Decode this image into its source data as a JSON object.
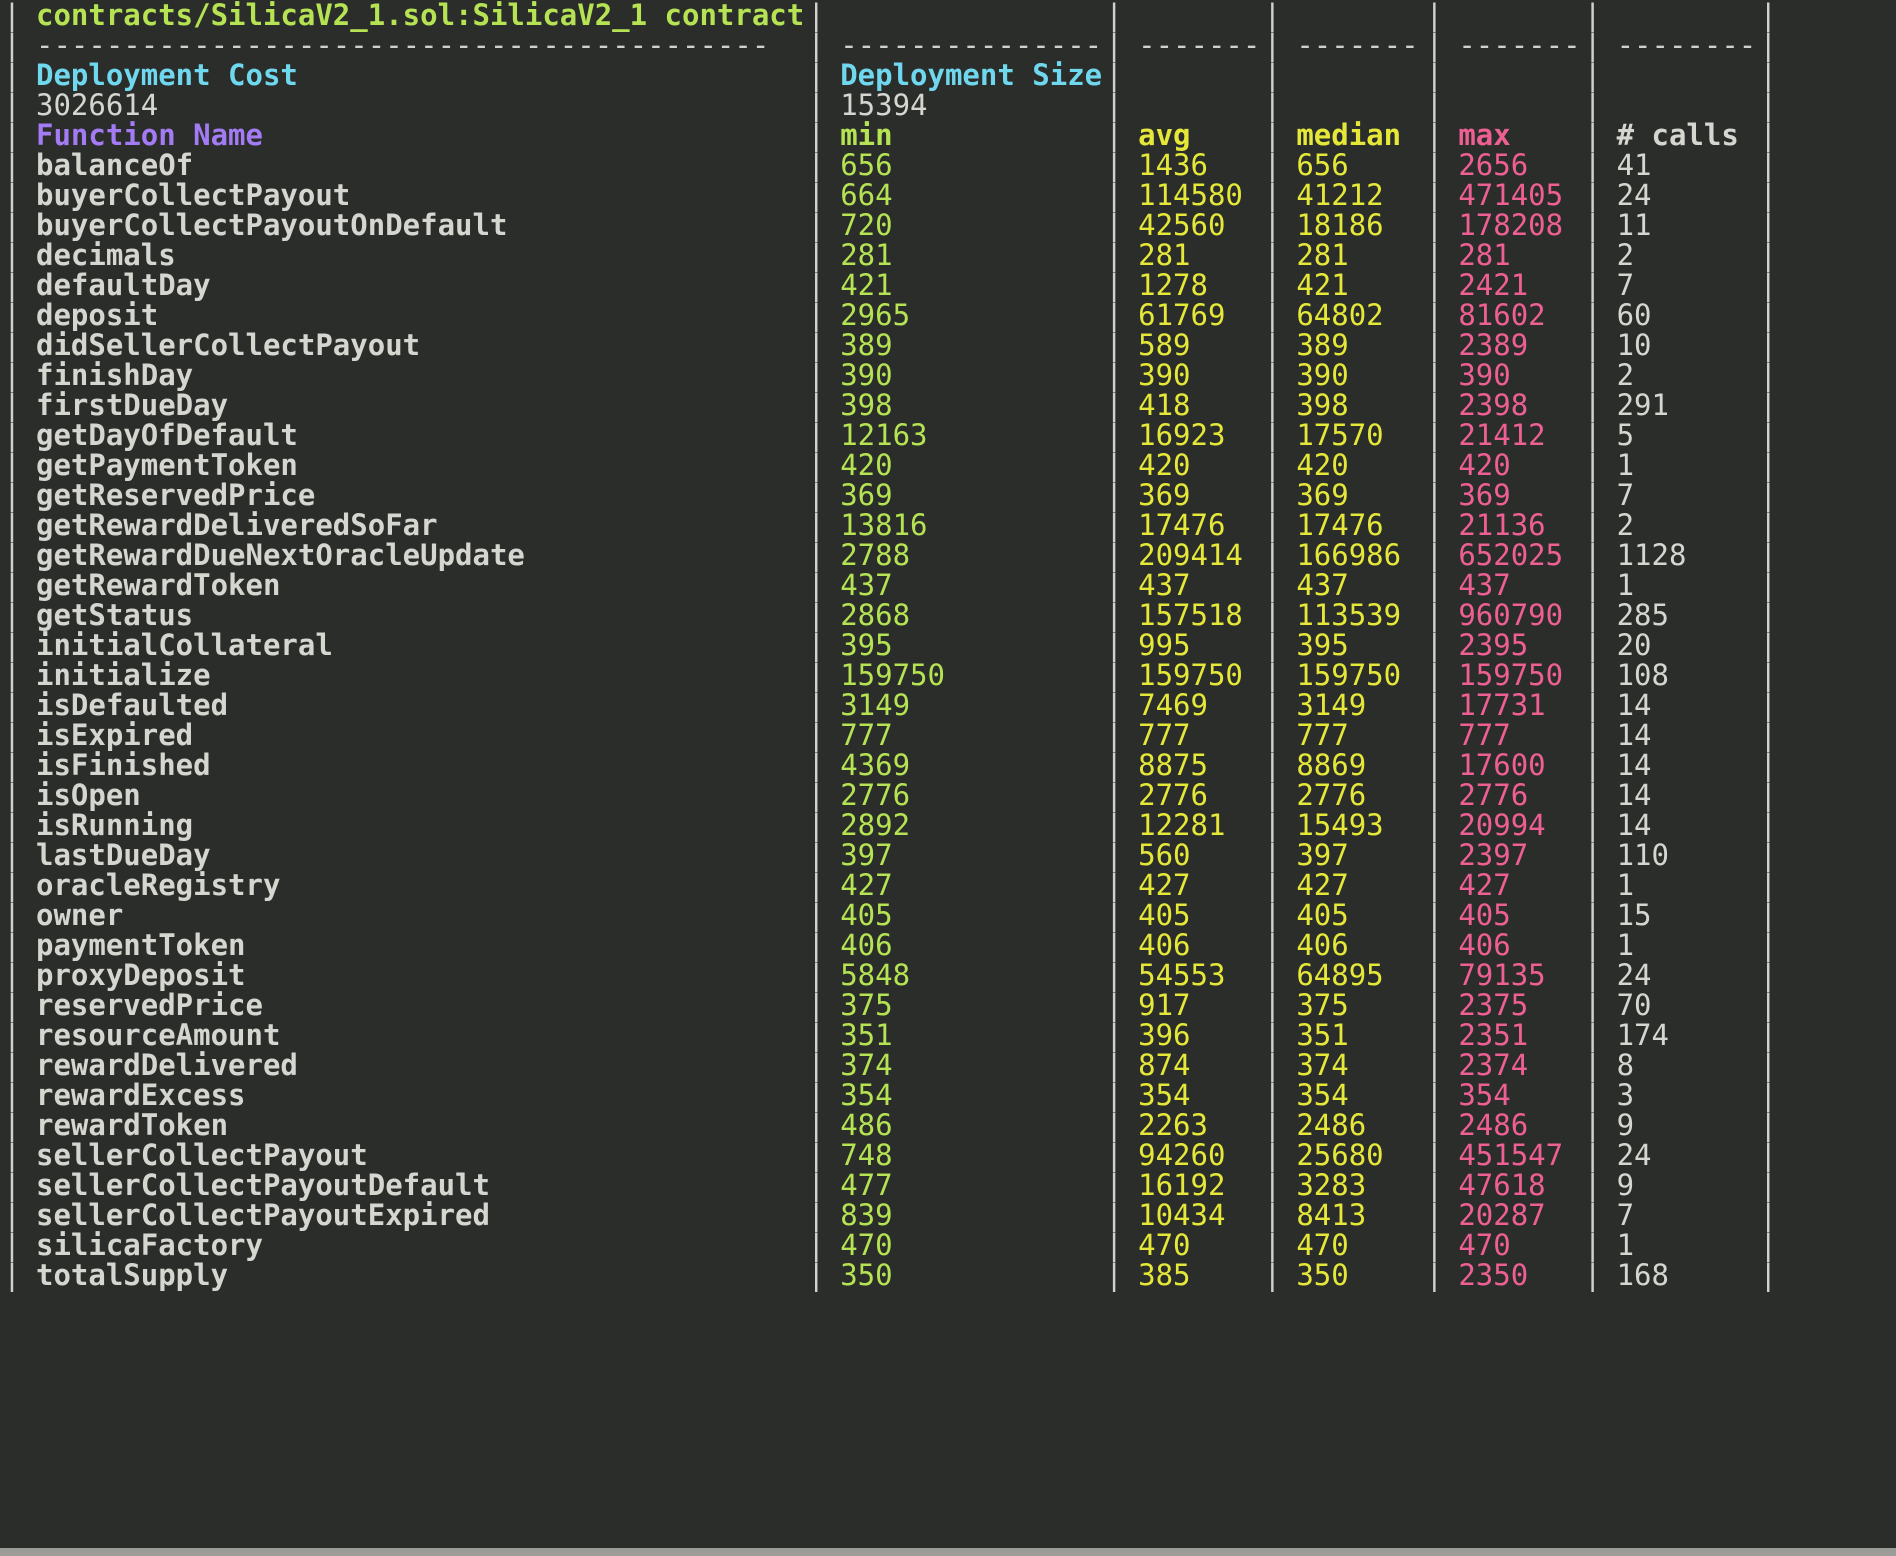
{
  "terminal": {
    "background_color": "#2b2d2a",
    "title_text": "contracts/SilicaV2_1.sol:SilicaV2_1 contract",
    "separator_char": "-"
  },
  "colors": {
    "title": "#b5e353",
    "header_cyan": "#6fd8ee",
    "header_purple": "#a37cf5",
    "min": "#b5e353",
    "avg": "#e5e839",
    "median": "#e5e839",
    "max": "#ee5f93",
    "calls": "#d6d6d1",
    "function_name": "#d6d6d1",
    "border": "#d0d0cd"
  },
  "deployment": {
    "cost_label": "Deployment Cost",
    "cost_value": "3026614",
    "size_label": "Deployment Size",
    "size_value": "15394"
  },
  "columns": {
    "function_name": "Function Name",
    "min": "min",
    "avg": "avg",
    "median": "median",
    "max": "max",
    "calls": "# calls"
  },
  "chart_data": {
    "type": "table",
    "title": "contracts/SilicaV2_1.sol:SilicaV2_1 contract",
    "columns": [
      "Function Name",
      "min",
      "avg",
      "median",
      "max",
      "# calls"
    ],
    "rows": [
      [
        "balanceOf",
        "656",
        "1436",
        "656",
        "2656",
        "41"
      ],
      [
        "buyerCollectPayout",
        "664",
        "114580",
        "41212",
        "471405",
        "24"
      ],
      [
        "buyerCollectPayoutOnDefault",
        "720",
        "42560",
        "18186",
        "178208",
        "11"
      ],
      [
        "decimals",
        "281",
        "281",
        "281",
        "281",
        "2"
      ],
      [
        "defaultDay",
        "421",
        "1278",
        "421",
        "2421",
        "7"
      ],
      [
        "deposit",
        "2965",
        "61769",
        "64802",
        "81602",
        "60"
      ],
      [
        "didSellerCollectPayout",
        "389",
        "589",
        "389",
        "2389",
        "10"
      ],
      [
        "finishDay",
        "390",
        "390",
        "390",
        "390",
        "2"
      ],
      [
        "firstDueDay",
        "398",
        "418",
        "398",
        "2398",
        "291"
      ],
      [
        "getDayOfDefault",
        "12163",
        "16923",
        "17570",
        "21412",
        "5"
      ],
      [
        "getPaymentToken",
        "420",
        "420",
        "420",
        "420",
        "1"
      ],
      [
        "getReservedPrice",
        "369",
        "369",
        "369",
        "369",
        "7"
      ],
      [
        "getRewardDeliveredSoFar",
        "13816",
        "17476",
        "17476",
        "21136",
        "2"
      ],
      [
        "getRewardDueNextOracleUpdate",
        "2788",
        "209414",
        "166986",
        "652025",
        "1128"
      ],
      [
        "getRewardToken",
        "437",
        "437",
        "437",
        "437",
        "1"
      ],
      [
        "getStatus",
        "2868",
        "157518",
        "113539",
        "960790",
        "285"
      ],
      [
        "initialCollateral",
        "395",
        "995",
        "395",
        "2395",
        "20"
      ],
      [
        "initialize",
        "159750",
        "159750",
        "159750",
        "159750",
        "108"
      ],
      [
        "isDefaulted",
        "3149",
        "7469",
        "3149",
        "17731",
        "14"
      ],
      [
        "isExpired",
        "777",
        "777",
        "777",
        "777",
        "14"
      ],
      [
        "isFinished",
        "4369",
        "8875",
        "8869",
        "17600",
        "14"
      ],
      [
        "isOpen",
        "2776",
        "2776",
        "2776",
        "2776",
        "14"
      ],
      [
        "isRunning",
        "2892",
        "12281",
        "15493",
        "20994",
        "14"
      ],
      [
        "lastDueDay",
        "397",
        "560",
        "397",
        "2397",
        "110"
      ],
      [
        "oracleRegistry",
        "427",
        "427",
        "427",
        "427",
        "1"
      ],
      [
        "owner",
        "405",
        "405",
        "405",
        "405",
        "15"
      ],
      [
        "paymentToken",
        "406",
        "406",
        "406",
        "406",
        "1"
      ],
      [
        "proxyDeposit",
        "5848",
        "54553",
        "64895",
        "79135",
        "24"
      ],
      [
        "reservedPrice",
        "375",
        "917",
        "375",
        "2375",
        "70"
      ],
      [
        "resourceAmount",
        "351",
        "396",
        "351",
        "2351",
        "174"
      ],
      [
        "rewardDelivered",
        "374",
        "874",
        "374",
        "2374",
        "8"
      ],
      [
        "rewardExcess",
        "354",
        "354",
        "354",
        "354",
        "3"
      ],
      [
        "rewardToken",
        "486",
        "2263",
        "2486",
        "2486",
        "9"
      ],
      [
        "sellerCollectPayout",
        "748",
        "94260",
        "25680",
        "451547",
        "24"
      ],
      [
        "sellerCollectPayoutDefault",
        "477",
        "16192",
        "3283",
        "47618",
        "9"
      ],
      [
        "sellerCollectPayoutExpired",
        "839",
        "10434",
        "8413",
        "20287",
        "7"
      ],
      [
        "silicaFactory",
        "470",
        "470",
        "470",
        "470",
        "1"
      ],
      [
        "totalSupply",
        "350",
        "385",
        "350",
        "2350",
        "168"
      ]
    ]
  }
}
